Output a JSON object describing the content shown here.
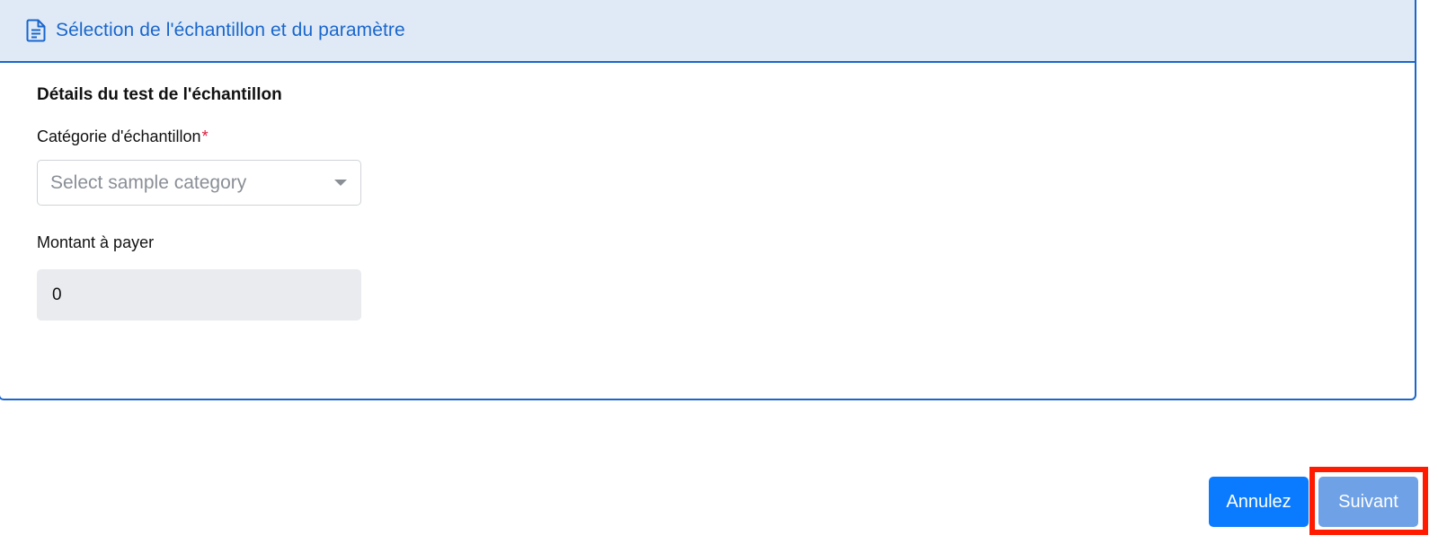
{
  "header": {
    "icon": "document-icon",
    "title": "Sélection de l'échantillon et du paramètre"
  },
  "form": {
    "section_title": "Détails du test de l'échantillon",
    "category": {
      "label": "Catégorie d'échantillon",
      "required_mark": "*",
      "placeholder": "Select sample category"
    },
    "amount": {
      "label": "Montant à payer",
      "value": "0"
    }
  },
  "actions": {
    "cancel_label": "Annulez",
    "next_label": "Suivant"
  },
  "colors": {
    "accent": "#1a66cc",
    "primary_button": "#0a7bff",
    "disabled_button": "#6fa1e6",
    "highlight": "#ff1a00",
    "required": "#e0193c"
  }
}
